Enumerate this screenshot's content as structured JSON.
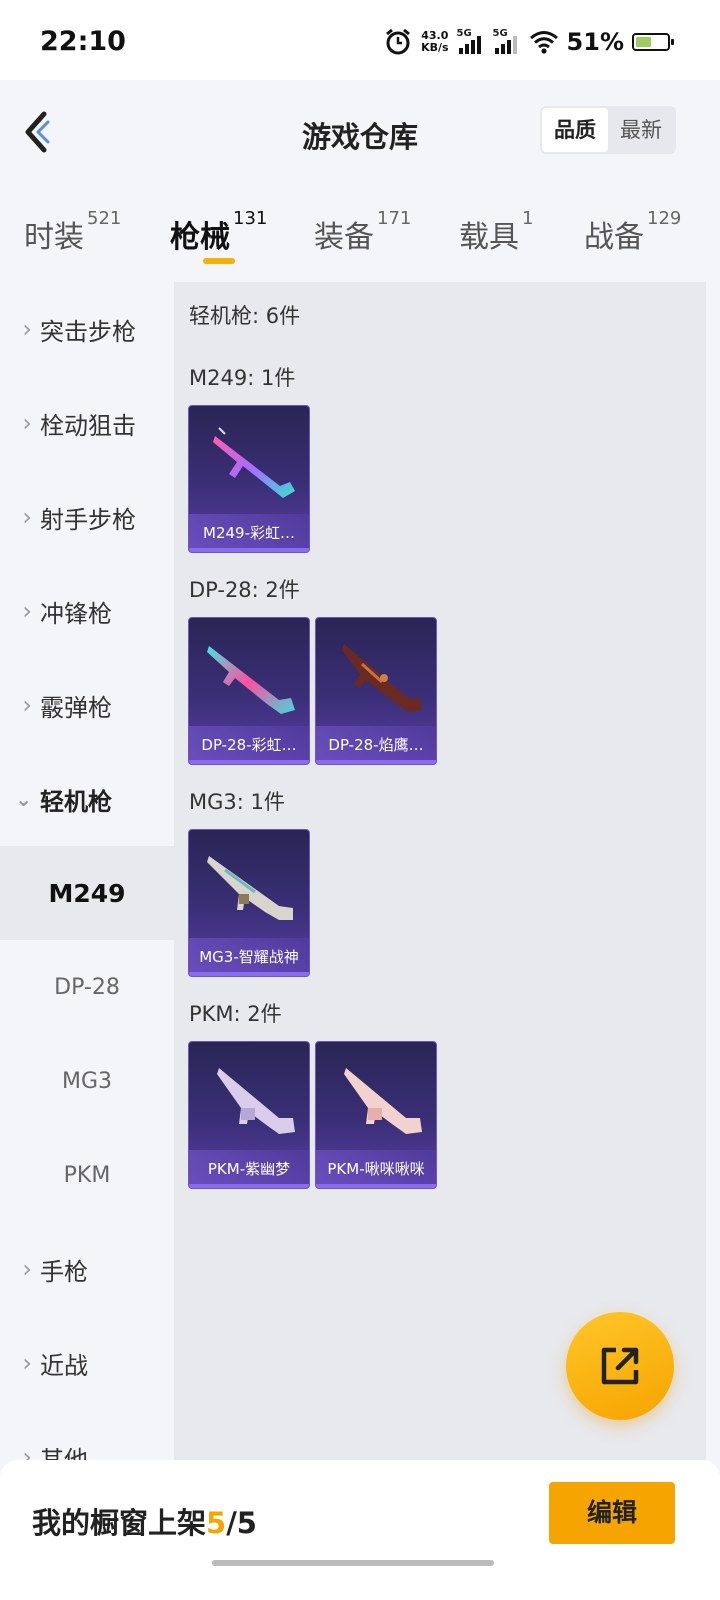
{
  "status_bar": {
    "time": "22:10",
    "net_speed_value": "43.0",
    "net_speed_unit": "KB/s",
    "sim1": "5G",
    "sim2": "5G",
    "battery": "51%",
    "battery_level": 0.51,
    "icons": [
      "alarm-icon",
      "signal-icon",
      "wifi-icon",
      "battery-icon"
    ]
  },
  "header": {
    "title": "游戏仓库",
    "sort_options": [
      "品质",
      "最新"
    ],
    "sort_selected": "品质"
  },
  "tabs": [
    {
      "label": "时装",
      "count": "521"
    },
    {
      "label": "枪械",
      "count": "131",
      "active": true
    },
    {
      "label": "装备",
      "count": "171"
    },
    {
      "label": "载具",
      "count": "1"
    },
    {
      "label": "战备",
      "count": "129"
    }
  ],
  "sidebar": {
    "items": [
      {
        "label": "突击步枪"
      },
      {
        "label": "栓动狙击"
      },
      {
        "label": "射手步枪"
      },
      {
        "label": "冲锋枪"
      },
      {
        "label": "霰弹枪"
      },
      {
        "label": "轻机枪",
        "expanded": true
      },
      {
        "label": "手枪"
      },
      {
        "label": "近战"
      },
      {
        "label": "其他"
      }
    ],
    "subitems": [
      {
        "label": "M249",
        "selected": true
      },
      {
        "label": "DP-28"
      },
      {
        "label": "MG3"
      },
      {
        "label": "PKM"
      }
    ]
  },
  "content": {
    "summary": "轻机枪: 6件",
    "groups": [
      {
        "title": "M249: 1件",
        "items": [
          {
            "name": "M249-彩虹…",
            "icon": "rainbow-m249-icon"
          }
        ]
      },
      {
        "title": "DP-28: 2件",
        "items": [
          {
            "name": "DP-28-彩虹…",
            "icon": "rainbow-dp28-icon"
          },
          {
            "name": "DP-28-焰鹰…",
            "icon": "flame-eagle-dp28-icon"
          }
        ]
      },
      {
        "title": "MG3: 1件",
        "items": [
          {
            "name": "MG3-智耀战神",
            "icon": "mg3-icon"
          }
        ]
      },
      {
        "title": "PKM: 2件",
        "items": [
          {
            "name": "PKM-紫幽梦",
            "icon": "pkm-purple-icon"
          },
          {
            "name": "PKM-啾咪啾咪",
            "icon": "pkm-pink-icon"
          }
        ]
      }
    ]
  },
  "fab": {
    "icon": "share-icon"
  },
  "bottom_bar": {
    "showcase_label": "我的橱窗上架",
    "showcase_current": "5",
    "showcase_sep": "/",
    "showcase_total": "5",
    "edit_label": "编辑"
  },
  "colors": {
    "accent": "#f6a400",
    "card_top": "#2a2555",
    "card_bottom": "#5a3ea5"
  }
}
